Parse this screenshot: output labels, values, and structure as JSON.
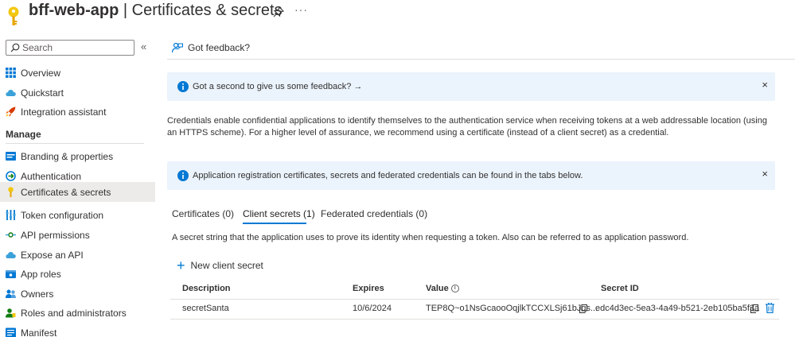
{
  "header": {
    "app_name": "bff-web-app",
    "separator": " | ",
    "page_name": "Certificates & secrets",
    "more_label": "···"
  },
  "sidebar": {
    "search_placeholder": "Search",
    "collapse_label": "«",
    "section_manage": "Manage",
    "items": [
      {
        "label": "Overview",
        "icon": "grid-icon"
      },
      {
        "label": "Quickstart",
        "icon": "cloud-icon"
      },
      {
        "label": "Integration assistant",
        "icon": "rocket-icon"
      },
      {
        "label": "Branding & properties",
        "icon": "branding-icon"
      },
      {
        "label": "Authentication",
        "icon": "authentication-icon"
      },
      {
        "label": "Certificates & secrets",
        "icon": "key-icon",
        "active": true
      },
      {
        "label": "Token configuration",
        "icon": "token-icon"
      },
      {
        "label": "API permissions",
        "icon": "permissions-icon"
      },
      {
        "label": "Expose an API",
        "icon": "cloud-icon"
      },
      {
        "label": "App roles",
        "icon": "app-roles-icon"
      },
      {
        "label": "Owners",
        "icon": "owners-icon"
      },
      {
        "label": "Roles and administrators",
        "icon": "roles-icon"
      },
      {
        "label": "Manifest",
        "icon": "manifest-icon"
      }
    ]
  },
  "main": {
    "feedback_label": "Got feedback?",
    "banner1": {
      "text": "Got a second to give us some feedback? →",
      "close": "×"
    },
    "description": "Credentials enable confidential applications to identify themselves to the authentication service when receiving tokens at a web addressable location (using an HTTPS scheme). For a higher level of assurance, we recommend using a certificate (instead of a client secret) as a credential.",
    "banner2": {
      "text": "Application registration certificates, secrets and federated credentials can be found in the tabs below.",
      "close": "×"
    },
    "tabs": [
      {
        "label": "Certificates (0)"
      },
      {
        "label": "Client secrets (1)",
        "active": true
      },
      {
        "label": "Federated credentials (0)"
      }
    ],
    "tab_description": "A secret string that the application uses to prove its identity when requesting a token. Also can be referred to as application password.",
    "new_secret_label": "New client secret",
    "table": {
      "headers": {
        "description": "Description",
        "expires": "Expires",
        "value": "Value",
        "secret_id": "Secret ID"
      },
      "value_info_glyph": "i",
      "rows": [
        {
          "description": "secretSanta",
          "expires": "10/6/2024",
          "value": "TEP8Q~o1NsGcaooOqjlkTCCXLSj61bJqs...",
          "secret_id": "edc4d3ec-5ea3-4a49-b521-2eb105ba5f3a"
        }
      ]
    }
  },
  "colors": {
    "accent": "#0078d4",
    "key_icon": "#f2c811",
    "banner_bg": "#ebf3fc",
    "active_nav_bg": "#edebe9"
  }
}
